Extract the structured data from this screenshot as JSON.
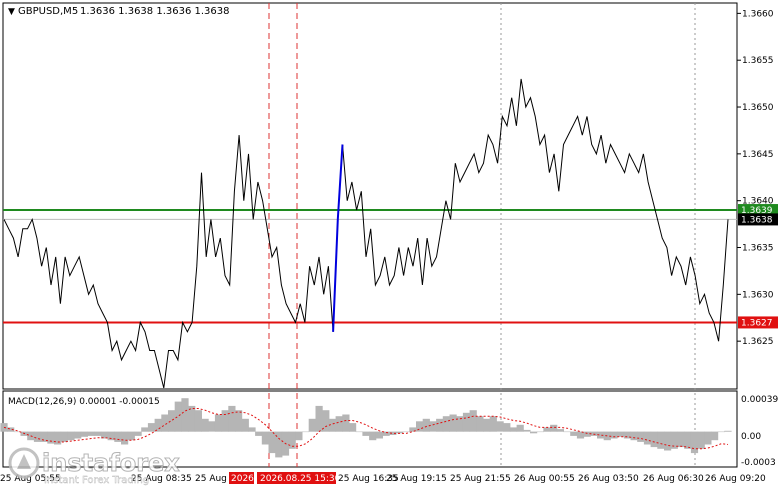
{
  "header": {
    "symbol": "GBPUSD,M5",
    "ohlc": "1.3636 1.3638 1.3636 1.3638"
  },
  "macd": {
    "label": "MACD(12,26,9) 0.00001 -0.00015"
  },
  "price_axis": {
    "ticks": [
      "1.3660",
      "1.3655",
      "1.3650",
      "1.3645",
      "1.3640",
      "1.3635",
      "1.3630",
      "1.3625"
    ],
    "green_level_label": "1.3639",
    "current_price_label": "1.3638",
    "red_level_label": "1.3627"
  },
  "macd_axis": {
    "ticks": [
      "0.00039",
      "0.00",
      "-0.0003"
    ]
  },
  "time_axis": {
    "ticks": [
      "25 Aug 05:55",
      "25 Aug 08:35",
      "25 Aug",
      "25 Aug 16:35",
      "25 Aug 19:15",
      "25 Aug 21:55",
      "26 Aug 00:55",
      "26 Aug 03:50",
      "26 Aug 06:30",
      "26 Aug 09:20"
    ],
    "highlight": "2026.08.25 15:30",
    "highlight_partial": "2026."
  },
  "watermark": {
    "brand": "instaforex",
    "tagline": "Instant Forex Trading"
  },
  "colors": {
    "green_level": "#1f8a1f",
    "red_level": "#e01010",
    "highlight_segment": "#0000dd",
    "marker_line": "#d33",
    "macd_hist": "#b5b5b5",
    "macd_signal": "#e01010"
  },
  "chart_data": {
    "type": "line",
    "ylim": [
      1.362,
      1.3661
    ],
    "levels": {
      "green": 1.3639,
      "red": 1.3627,
      "current": 1.3638
    },
    "series": [
      {
        "values": [
          1.3638,
          1.3637,
          1.3636,
          1.3634,
          1.3637,
          1.3637,
          1.3638,
          1.3636,
          1.3633,
          1.3635,
          1.3631,
          1.3634,
          1.3629,
          1.3634,
          1.3632,
          1.3633,
          1.3634,
          1.3632,
          1.363,
          1.3631,
          1.3629,
          1.3628,
          1.3627,
          1.3624,
          1.3625,
          1.3623,
          1.3624,
          1.3625,
          1.3624,
          1.3627,
          1.3626,
          1.3624,
          1.3624,
          1.3622,
          1.362,
          1.3624,
          1.3624,
          1.3623,
          1.3627,
          1.3626,
          1.3627,
          1.3633,
          1.3643,
          1.3634,
          1.3638,
          1.3634,
          1.3636,
          1.3632,
          1.3631,
          1.3641,
          1.3647,
          1.364,
          1.3645,
          1.3638,
          1.3642,
          1.364,
          1.3637,
          1.3634,
          1.3635,
          1.3631,
          1.3629,
          1.3628,
          1.3627,
          1.3629,
          1.3627,
          1.3633,
          1.3631,
          1.3634,
          1.363,
          1.3633,
          1.3626,
          1.3638,
          1.3646,
          1.364,
          1.3642,
          1.3639,
          1.3641,
          1.3634,
          1.3637,
          1.3631,
          1.3632,
          1.3634,
          1.3631,
          1.3632,
          1.3635,
          1.3632,
          1.3635,
          1.3633,
          1.3636,
          1.3631,
          1.3636,
          1.3633,
          1.3634,
          1.3637,
          1.364,
          1.3638,
          1.3644,
          1.3642,
          1.3643,
          1.3644,
          1.3645,
          1.3643,
          1.3644,
          1.3647,
          1.3646,
          1.3644,
          1.3649,
          1.3648,
          1.3651,
          1.3648,
          1.3653,
          1.365,
          1.3651,
          1.3649,
          1.3646,
          1.3647,
          1.3643,
          1.3645,
          1.3641,
          1.3646,
          1.3647,
          1.3648,
          1.3649,
          1.3647,
          1.3649,
          1.3646,
          1.3645,
          1.3647,
          1.3644,
          1.3646,
          1.3645,
          1.3644,
          1.3643,
          1.3645,
          1.3644,
          1.3643,
          1.3645,
          1.3642,
          1.364,
          1.3638,
          1.3636,
          1.3635,
          1.3632,
          1.3634,
          1.3633,
          1.3631,
          1.3634,
          1.3632,
          1.3629,
          1.363,
          1.3628,
          1.3627,
          1.3625,
          1.3631,
          1.3638
        ]
      },
      {
        "name": "",
        "values": []
      }
    ],
    "highlight_segment": {
      "start_index": 70,
      "end_index": 72
    },
    "macd": {
      "ylim": [
        -0.0004,
        0.00045
      ],
      "histogram": [
        0.0001,
        5e-05,
        0,
        -5e-05,
        -0.0001,
        -0.00012,
        -0.00012,
        -0.00014,
        -0.00015,
        -0.00012,
        -0.0001,
        -8e-05,
        -6e-05,
        -5e-05,
        -5e-05,
        -8e-05,
        -0.0001,
        -0.00012,
        -0.00015,
        -0.0001,
        -5e-05,
        5e-05,
        0.0001,
        0.00015,
        0.0002,
        0.00025,
        0.00035,
        0.00039,
        0.0003,
        0.00025,
        0.00015,
        0.00012,
        0.0002,
        0.00025,
        0.0003,
        0.00025,
        0.00015,
        5e-05,
        -5e-05,
        -0.00015,
        -0.00025,
        -0.0003,
        -0.00028,
        -0.0002,
        -0.0001,
        0,
        0.00015,
        0.0003,
        0.00025,
        0.00015,
        0.00018,
        0.0002,
        0.0001,
        0,
        -5e-05,
        -0.0001,
        -8e-05,
        -5e-05,
        -4e-05,
        -2e-05,
        0,
        5e-05,
        0.00012,
        0.00015,
        0.00012,
        0.00015,
        0.00018,
        0.0002,
        0.00018,
        0.00022,
        0.00025,
        0.00018,
        0.00015,
        0.00018,
        0.00012,
        0.0001,
        5e-05,
        8e-05,
        2e-05,
        -2e-05,
        0,
        5e-05,
        8e-05,
        3e-05,
        0,
        -5e-05,
        -8e-05,
        -6e-05,
        -5e-05,
        -8e-05,
        -0.0001,
        -8e-05,
        -6e-05,
        -8e-05,
        -0.0001,
        -0.00012,
        -0.00015,
        -0.00018,
        -0.0002,
        -0.00022,
        -0.0002,
        -0.00018,
        -0.0002,
        -0.00025,
        -0.0002,
        -0.00015,
        -0.0001,
        0,
        1e-05
      ],
      "signal": [
        5e-05,
        3e-05,
        1e-05,
        -2e-05,
        -5e-05,
        -8e-05,
        -0.0001,
        -0.00011,
        -0.00012,
        -0.00012,
        -0.00011,
        -0.0001,
        -9e-05,
        -8e-05,
        -7e-05,
        -7e-05,
        -8e-05,
        -9e-05,
        -0.0001,
        -0.0001,
        -9e-05,
        -6e-05,
        -2e-05,
        3e-05,
        8e-05,
        0.00013,
        0.00018,
        0.00024,
        0.00027,
        0.00027,
        0.00025,
        0.00022,
        0.0002,
        0.0002,
        0.00022,
        0.00023,
        0.00022,
        0.00019,
        0.00014,
        8e-05,
        0,
        -8e-05,
        -0.00014,
        -0.00017,
        -0.00017,
        -0.00014,
        -8e-05,
        0,
        6e-05,
        9e-05,
        0.00011,
        0.00013,
        0.00013,
        0.00011,
        8e-05,
        4e-05,
        1e-05,
        -1e-05,
        -2e-05,
        -2e-05,
        -2e-05,
        0,
        3e-05,
        6e-05,
        8e-05,
        0.0001,
        0.00012,
        0.00014,
        0.00015,
        0.00016,
        0.00018,
        0.00018,
        0.00018,
        0.00018,
        0.00017,
        0.00015,
        0.00013,
        0.00012,
        0.0001,
        7e-05,
        5e-05,
        5e-05,
        5e-05,
        5e-05,
        4e-05,
        2e-05,
        0,
        -2e-05,
        -3e-05,
        -4e-05,
        -5e-05,
        -6e-05,
        -6e-05,
        -6e-05,
        -7e-05,
        -8e-05,
        -0.0001,
        -0.00012,
        -0.00014,
        -0.00016,
        -0.00017,
        -0.00017,
        -0.00018,
        -0.0002,
        -0.0002,
        -0.00019,
        -0.00017,
        -0.00014,
        -0.00015
      ]
    }
  }
}
